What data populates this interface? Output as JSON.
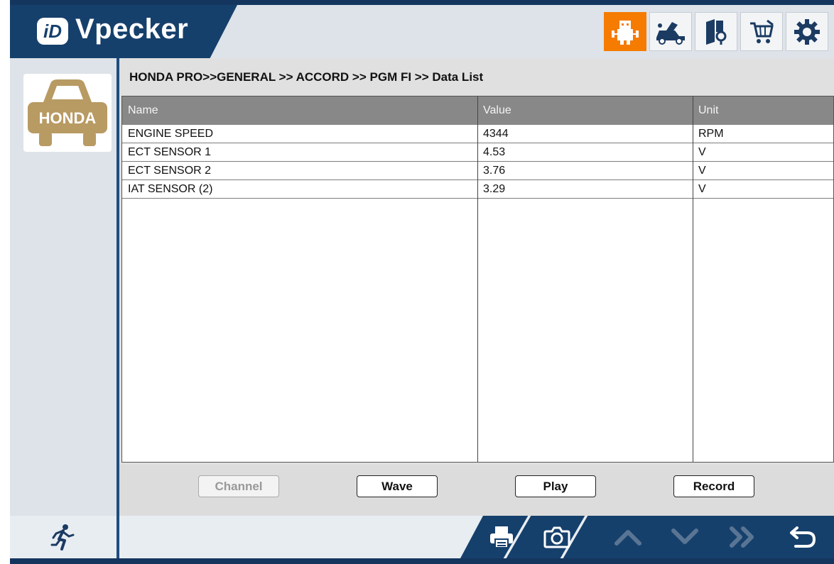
{
  "brand": {
    "name": "Vpecker",
    "badge": "iD"
  },
  "topbar": {
    "icons": [
      {
        "name": "diagnosis-robot-icon",
        "active": true
      },
      {
        "name": "car-repair-icon",
        "active": false
      },
      {
        "name": "manual-book-icon",
        "active": false
      },
      {
        "name": "shopping-cart-icon",
        "active": false
      },
      {
        "name": "gear-icon",
        "active": false
      }
    ]
  },
  "sidebar": {
    "brand_logo_text": "HONDA"
  },
  "breadcrumb": "HONDA PRO>>GENERAL >> ACCORD >> PGM FI >> Data List",
  "table": {
    "headers": {
      "name": "Name",
      "value": "Value",
      "unit": "Unit"
    },
    "rows": [
      {
        "name": "ENGINE SPEED",
        "value": "4344",
        "unit": "RPM"
      },
      {
        "name": "ECT SENSOR 1",
        "value": "4.53",
        "unit": "V"
      },
      {
        "name": "ECT SENSOR 2",
        "value": "3.76",
        "unit": "V"
      },
      {
        "name": "IAT SENSOR (2)",
        "value": "3.29",
        "unit": "V"
      }
    ]
  },
  "buttons": {
    "channel": "Channel",
    "wave": "Wave",
    "play": "Play",
    "record": "Record"
  },
  "bottombar": {
    "icons": [
      "running-man-icon",
      "printer-icon",
      "camera-icon",
      "chevron-up-icon",
      "chevron-down-icon",
      "double-chevron-right-icon",
      "back-arrow-icon"
    ]
  },
  "colors": {
    "accent": "#f57c00",
    "navy": "#16406c",
    "header_gray": "#888888"
  }
}
